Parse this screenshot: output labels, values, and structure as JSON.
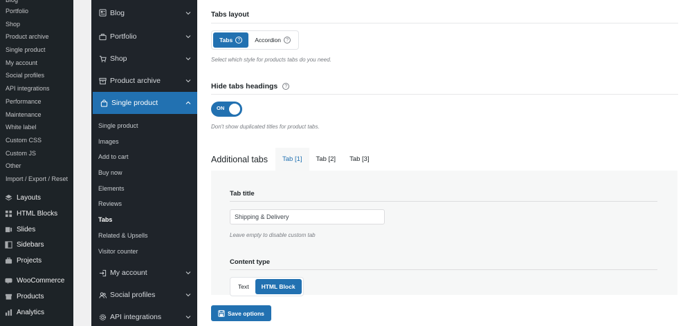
{
  "wp_sidebar": {
    "submenu": [
      "Blog",
      "Portfolio",
      "Shop",
      "Product archive",
      "Single product",
      "My account",
      "Social profiles",
      "API integrations",
      "Performance",
      "Maintenance",
      "White label",
      "Custom CSS",
      "Custom JS",
      "Other",
      "Import / Export / Reset"
    ],
    "menu": [
      {
        "label": "Layouts",
        "icon": "layers-icon"
      },
      {
        "label": "HTML Blocks",
        "icon": "grid-icon"
      },
      {
        "label": "Slides",
        "icon": "slides-icon"
      },
      {
        "label": "Sidebars",
        "icon": "sidebar-icon"
      },
      {
        "label": "Projects",
        "icon": "briefcase-icon"
      },
      {
        "label": "WooCommerce",
        "icon": "woo-icon"
      },
      {
        "label": "Products",
        "icon": "archive-icon"
      },
      {
        "label": "Analytics",
        "icon": "bar-chart-icon"
      }
    ]
  },
  "options_nav": {
    "items_top": [
      {
        "label": "Blog",
        "icon": "blog-icon"
      },
      {
        "label": "Portfolio",
        "icon": "portfolio-icon"
      },
      {
        "label": "Shop",
        "icon": "cart-icon"
      },
      {
        "label": "Product archive",
        "icon": "archive-icon"
      }
    ],
    "active": {
      "label": "Single product",
      "icon": "bag-icon"
    },
    "subitems": [
      "Single product",
      "Images",
      "Add to cart",
      "Buy now",
      "Elements",
      "Reviews",
      "Tabs",
      "Related & Upsells",
      "Visitor counter"
    ],
    "active_subitem": "Tabs",
    "items_bottom": [
      {
        "label": "My account",
        "icon": "login-icon"
      },
      {
        "label": "Social profiles",
        "icon": "users-icon"
      },
      {
        "label": "API integrations",
        "icon": "gear-icon"
      }
    ]
  },
  "main": {
    "tabs_layout": {
      "title": "Tabs layout",
      "options": [
        "Tabs",
        "Accordion"
      ],
      "selected": "Tabs",
      "hint": "Select which style for products tabs do you need."
    },
    "hide_headings": {
      "title": "Hide tabs headings",
      "toggle_label": "ON",
      "hint": "Don't show duplicated titles for product tabs."
    },
    "additional_tabs": {
      "title": "Additional tabs",
      "tabs": [
        "Tab [1]",
        "Tab [2]",
        "Tab [3]"
      ],
      "active_tab": "Tab [1]",
      "tab_title_label": "Tab title",
      "tab_title_value": "Shipping & Delivery",
      "tab_title_hint": "Leave empty to disable custom tab",
      "content_type_label": "Content type",
      "content_types": [
        "Text",
        "HTML Block"
      ],
      "content_type_selected": "HTML Block"
    },
    "save_label": "Save options"
  },
  "colors": {
    "accent": "#2271b1",
    "wp_sidebar_bg": "#1d2327",
    "nav_bg": "#1f242a"
  }
}
